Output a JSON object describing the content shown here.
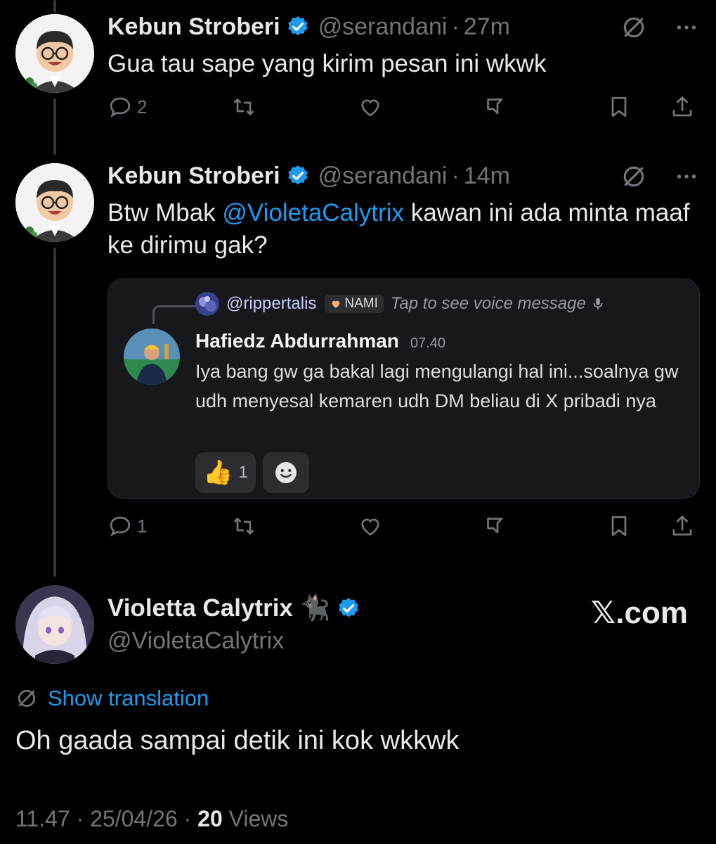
{
  "tweet1": {
    "name": "Kebun Stroberi",
    "handle": "@serandani",
    "time": "27m",
    "text": "Gua tau sape yang kirim pesan ini wkwk",
    "reply_count": "2"
  },
  "tweet2": {
    "name": "Kebun Stroberi",
    "handle": "@serandani",
    "time": "14m",
    "text_before": "Btw Mbak ",
    "mention": "@VioletaCalytrix",
    "text_after": " kawan ini ada minta maaf ke dirimu gak?",
    "reply_count": "1",
    "embed": {
      "reply_user": "@rippertalis",
      "tag": "NAMI",
      "reply_msg": "Tap to see voice message",
      "author": "Hafiedz Abdurrahman",
      "time": "07.40",
      "message": "Iya bang gw ga bakal lagi mengulangi hal ini...soalnya gw udh menyesal kemaren udh DM beliau di X pribadi nya",
      "reaction_emoji": "👍",
      "reaction_count": "1"
    }
  },
  "tweet3": {
    "name": "Violetta Calytrix",
    "name_emoji": "🐈‍⬛",
    "handle": "@VioletaCalytrix",
    "brand": "𝕏.com",
    "show_translation": "Show translation",
    "text": "Oh gaada sampai detik ini kok wkkwk",
    "time": "11.47",
    "date": "25/04/26",
    "views_count": "20",
    "views_label": "Views"
  },
  "colors": {
    "background": "#000000",
    "text": "#e7e9ea",
    "muted": "#71767b",
    "accent": "#1d9bf0",
    "embed_bg": "#17181b"
  },
  "icons": [
    "verified-badge-icon",
    "translate-icon",
    "more-icon",
    "reply-icon",
    "retweet-icon",
    "like-icon",
    "grok-icon",
    "bookmark-icon",
    "share-icon",
    "smiley-add-icon",
    "mic-icon",
    "heart-tag-icon"
  ]
}
